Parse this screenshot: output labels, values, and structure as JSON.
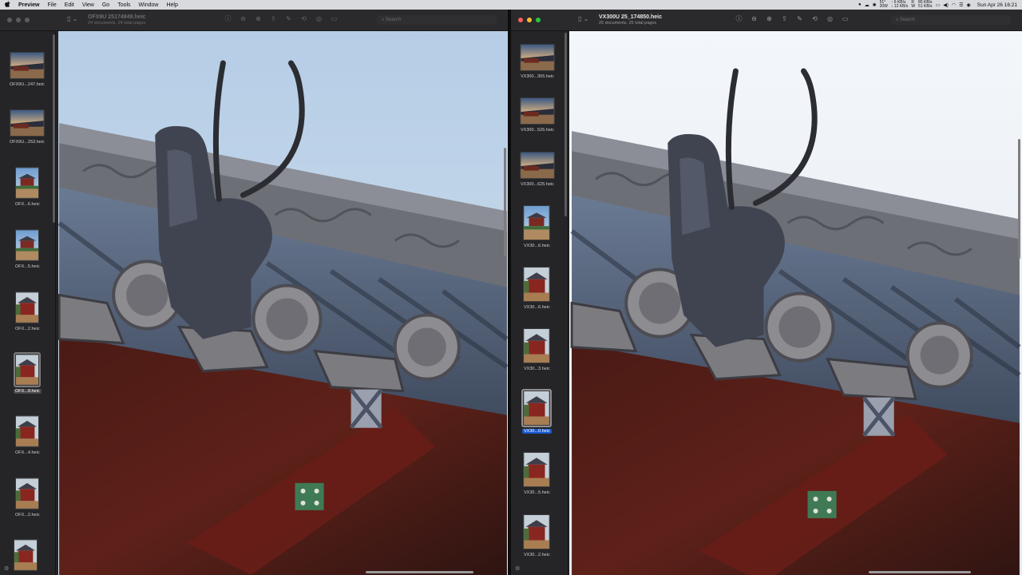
{
  "menubar": {
    "apple": "",
    "items": [
      "Preview",
      "File",
      "Edit",
      "View",
      "Go",
      "Tools",
      "Window",
      "Help"
    ],
    "status": {
      "temp_line1": "51°",
      "temp_line2": "20W",
      "net1": "↑ 6 KB/s",
      "net2": "↓ 12 KB/s",
      "net_r": "R",
      "net_w": "W",
      "disk1": "85 KB/s",
      "disk2": "51 KB/s",
      "clock": "Sun Apr 26  16:21"
    }
  },
  "window_left": {
    "title": "OFX9U 25174849.heic",
    "subtitle": "24 documents, 24 total pages",
    "search_placeholder": "Search",
    "thumbnails": [
      {
        "label": "OFX9U...247.heic"
      },
      {
        "label": "OFX9U...253.heic"
      },
      {
        "label": "OFX...6.heic"
      },
      {
        "label": "OFX...5.heic"
      },
      {
        "label": "OFX...2.heic"
      },
      {
        "label": "OFX...9.heic"
      },
      {
        "label": "OFX...4.heic"
      },
      {
        "label": "OFX...2.heic"
      },
      {
        "label": ""
      }
    ]
  },
  "window_right": {
    "title": "VX300U 25_174850.heic",
    "subtitle": "25 documents, 25 total pages",
    "search_placeholder": "Search",
    "thumbnails": [
      {
        "label": "VX300...355.heic"
      },
      {
        "label": "VX300...526.heic"
      },
      {
        "label": "VX300...625.heic"
      },
      {
        "label": "VX30...6.heic"
      },
      {
        "label": "VX30...6.heic"
      },
      {
        "label": "VX30...3.heic"
      },
      {
        "label": "VX30...0.heic"
      },
      {
        "label": "VX30...5.heic"
      },
      {
        "label": "VX30...2.heic"
      }
    ]
  },
  "colors": {
    "selection_blue": "#1959d1",
    "sky_left": "#bcd3ea",
    "sky_right": "#eef3f8",
    "roof_tile": "#4e5d74",
    "beam_red": "#6b1c18"
  }
}
